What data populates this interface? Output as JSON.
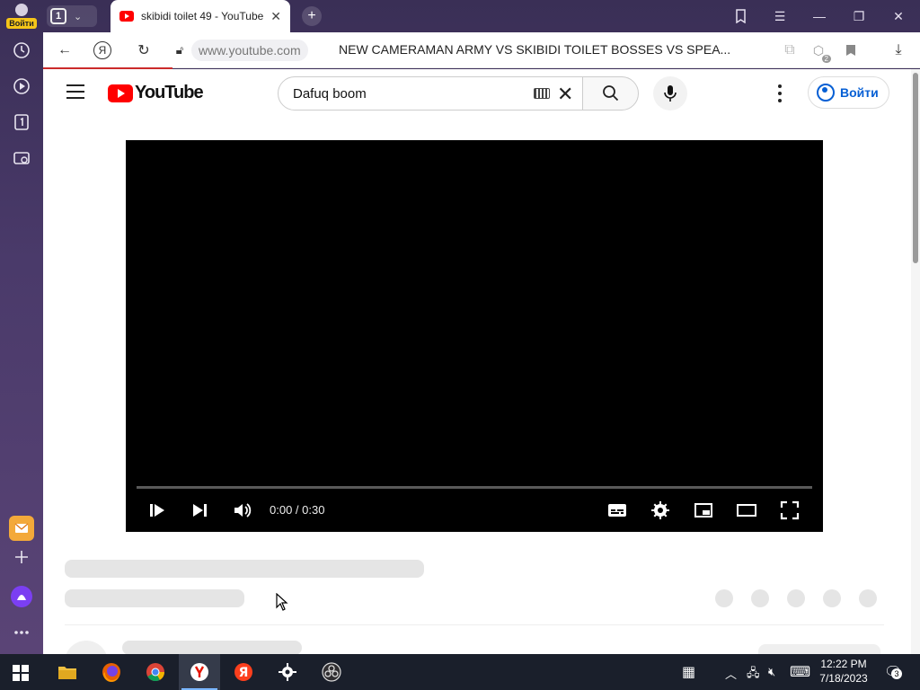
{
  "browser": {
    "login_label": "Войти",
    "tab_count": "1",
    "active_tab_title": "skibidi toilet 49 - YouTube",
    "url_domain": "www.youtube.com",
    "page_title": "NEW CAMERAMAN ARMY VS SKIBIDI TOILET BOSSES VS SPEA...",
    "bookmarks_badge": "2",
    "accent_color": "#cc2b2b"
  },
  "youtube": {
    "logo_text": "YouTube",
    "search_query": "Dafuq boom",
    "signin_label": "Войти",
    "player": {
      "time_display": "0:00 / 0:30",
      "progress_fraction": 0
    }
  },
  "taskbar": {
    "clock_time": "12:22 PM",
    "clock_date": "7/18/2023",
    "notifications_count": "3",
    "apps": [
      "file-explorer",
      "firefox",
      "chrome",
      "yandex-browser",
      "yandex",
      "settings",
      "obs"
    ]
  }
}
